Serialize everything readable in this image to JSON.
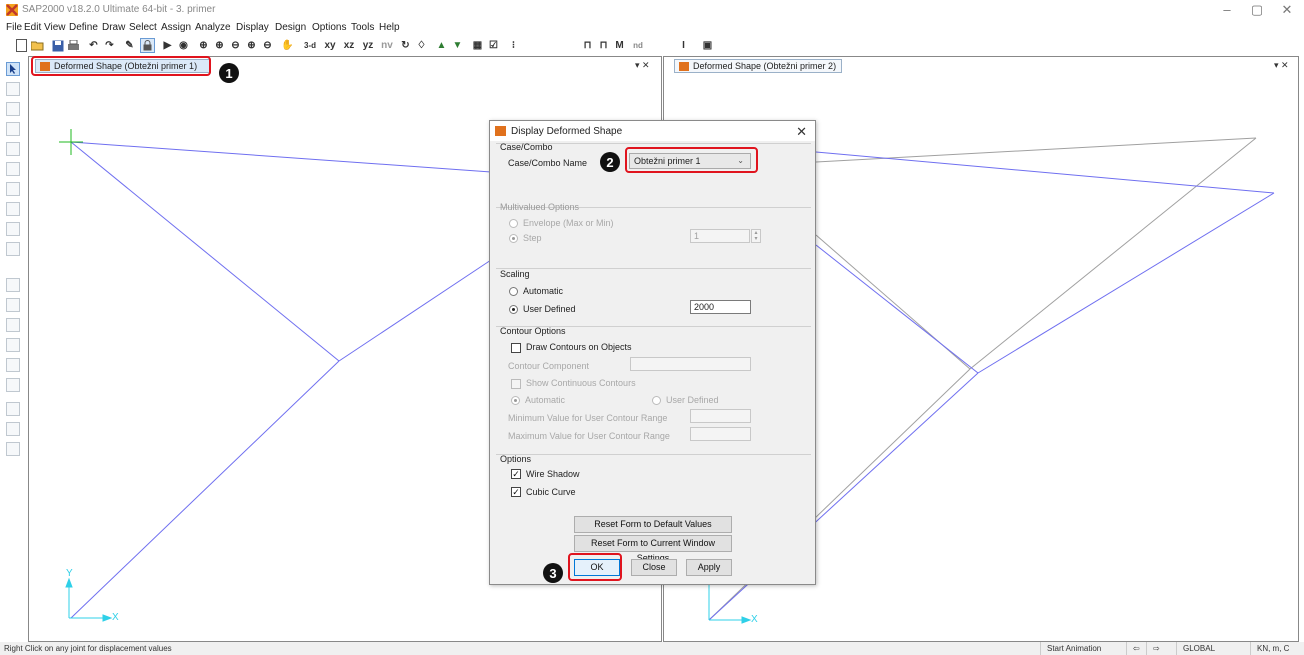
{
  "window": {
    "title": "SAP2000 v18.2.0 Ultimate 64-bit - 3. primer",
    "minimize": "–",
    "maximize": "▢",
    "close": "✕"
  },
  "menu": [
    "File",
    "Edit",
    "View",
    "Define",
    "Draw",
    "Select",
    "Assign",
    "Analyze",
    "Display",
    "Design",
    "Options",
    "Tools",
    "Help"
  ],
  "toolbar": {
    "view_3d": "3-d",
    "view_xy": "xy",
    "view_xz": "xz",
    "view_yz": "yz",
    "view_nv": "nv",
    "nd": "nd"
  },
  "left_pane": {
    "tab_title": "Deformed Shape (Obtežni primer 1)",
    "controls": "▾ ✕",
    "axis_y": "Y",
    "axis_x": "X"
  },
  "right_pane": {
    "tab_title": "Deformed Shape (Obtežni primer 2)",
    "controls": "▾ ✕",
    "axis_x": "X"
  },
  "callouts": [
    "1",
    "2",
    "3"
  ],
  "dialog": {
    "title": "Display Deformed Shape",
    "close": "✕",
    "case_combo": {
      "group_label": "Case/Combo",
      "name_label": "Case/Combo Name",
      "selected": "Obtežni primer 1"
    },
    "multivalued": {
      "group_label": "Multivalued Options",
      "envelope_label": "Envelope (Max or Min)",
      "step_label": "Step",
      "step_value": "1"
    },
    "scaling": {
      "group_label": "Scaling",
      "automatic_label": "Automatic",
      "user_defined_label": "User Defined",
      "user_value": "2000"
    },
    "contour": {
      "group_label": "Contour Options",
      "draw_label": "Draw Contours on Objects",
      "component_label": "Contour Component",
      "continuous_label": "Show Continuous Contours",
      "automatic_label": "Automatic",
      "user_defined_label": "User Defined",
      "min_label": "Minimum Value for User Contour Range",
      "max_label": "Maximum Value for User Contour Range"
    },
    "options": {
      "group_label": "Options",
      "wire_shadow_label": "Wire Shadow",
      "cubic_curve_label": "Cubic Curve",
      "check_mark": "✓"
    },
    "buttons": {
      "reset_default": "Reset Form to Default Values",
      "reset_current": "Reset Form to Current Window Settings",
      "ok": "OK",
      "close": "Close",
      "apply": "Apply"
    }
  },
  "status": {
    "hint": "Right Click on any joint for displacement values",
    "start_animation": "Start Animation",
    "prev": "⇦",
    "next": "⇨",
    "coord_system": "GLOBAL",
    "units": "KN, m, C"
  },
  "colors": {
    "accent_red": "#e0141e",
    "deformed_line": "#6f6ff0",
    "undeformed_line": "#a0a0a0",
    "axis_cyan": "#2fd0e8",
    "joint_green": "#1fb81f"
  }
}
